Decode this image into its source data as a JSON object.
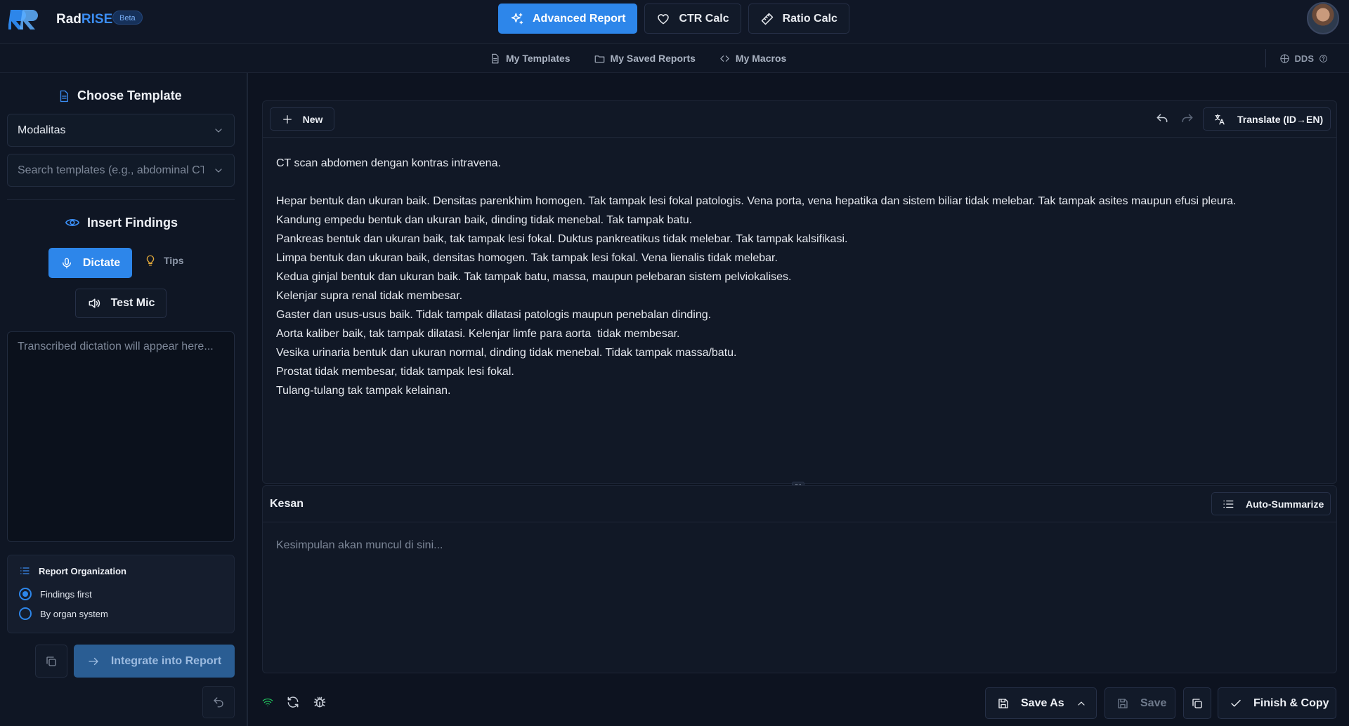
{
  "brand": {
    "name_part1": "Rad",
    "name_part2": "RISE",
    "badge": "Beta"
  },
  "topnav": [
    {
      "label": "Advanced Report",
      "icon": "sparkles-icon",
      "active": true
    },
    {
      "label": "CTR Calc",
      "icon": "heart-icon",
      "active": false
    },
    {
      "label": "Ratio Calc",
      "icon": "ruler-icon",
      "active": false
    }
  ],
  "subnav": [
    {
      "label": "My Templates",
      "icon": "document-icon"
    },
    {
      "label": "My Saved Reports",
      "icon": "folder-icon"
    },
    {
      "label": "My Macros",
      "icon": "code-icon"
    }
  ],
  "dds": {
    "label": "DDS"
  },
  "sidebar": {
    "choose_template": "Choose Template",
    "modality_value": "Modalitas",
    "search_placeholder": "Search templates (e.g., abdominal CT)",
    "insert_findings": "Insert Findings",
    "dictate": "Dictate",
    "tips": "Tips",
    "test_mic": "Test Mic",
    "dictation_placeholder": "Transcribed dictation will appear here...",
    "report_organization": {
      "title": "Report Organization",
      "options": [
        {
          "label": "Findings first",
          "selected": true
        },
        {
          "label": "By organ system",
          "selected": false
        }
      ]
    },
    "integrate": "Integrate into Report"
  },
  "editor": {
    "new_label": "New",
    "translate_label": "Translate (ID→EN)",
    "lines": [
      "CT scan abdomen dengan kontras intravena.",
      "",
      "Hepar bentuk dan ukuran baik. Densitas parenkhim homogen. Tak tampak lesi fokal patologis. Vena porta, vena hepatika dan sistem biliar tidak melebar. Tak tampak asites maupun efusi pleura.",
      "Kandung empedu bentuk dan ukuran baik, dinding tidak menebal. Tak tampak batu.",
      "Pankreas bentuk dan ukuran baik, tak tampak lesi fokal. Duktus pankreatikus tidak melebar. Tak tampak kalsifikasi.",
      "Limpa bentuk dan ukuran baik, densitas homogen. Tak tampak lesi fokal. Vena lienalis tidak melebar.",
      "Kedua ginjal bentuk dan ukuran baik. Tak tampak batu, massa, maupun pelebaran sistem pelviokalises.",
      "Kelenjar supra renal tidak membesar.",
      "Gaster dan usus-usus baik. Tidak tampak dilatasi patologis maupun penebalan dinding.",
      "Aorta kaliber baik, tak tampak dilatasi. Kelenjar limfe para aorta  tidak membesar.",
      "Vesika urinaria bentuk dan ukuran normal, dinding tidak menebal. Tidak tampak massa/batu.",
      "Prostat tidak membesar, tidak tampak lesi fokal.",
      "Tulang-tulang tak tampak kelainan."
    ]
  },
  "kesan": {
    "title": "Kesan",
    "auto_summarize": "Auto-Summarize",
    "placeholder": "Kesimpulan akan muncul di sini..."
  },
  "footer": {
    "save_as": "Save As",
    "save": "Save",
    "finish_copy": "Finish & Copy"
  },
  "colors": {
    "accent": "#2d86ea",
    "background": "#0d1320",
    "panel": "#111826",
    "wifi": "#22c55e"
  }
}
